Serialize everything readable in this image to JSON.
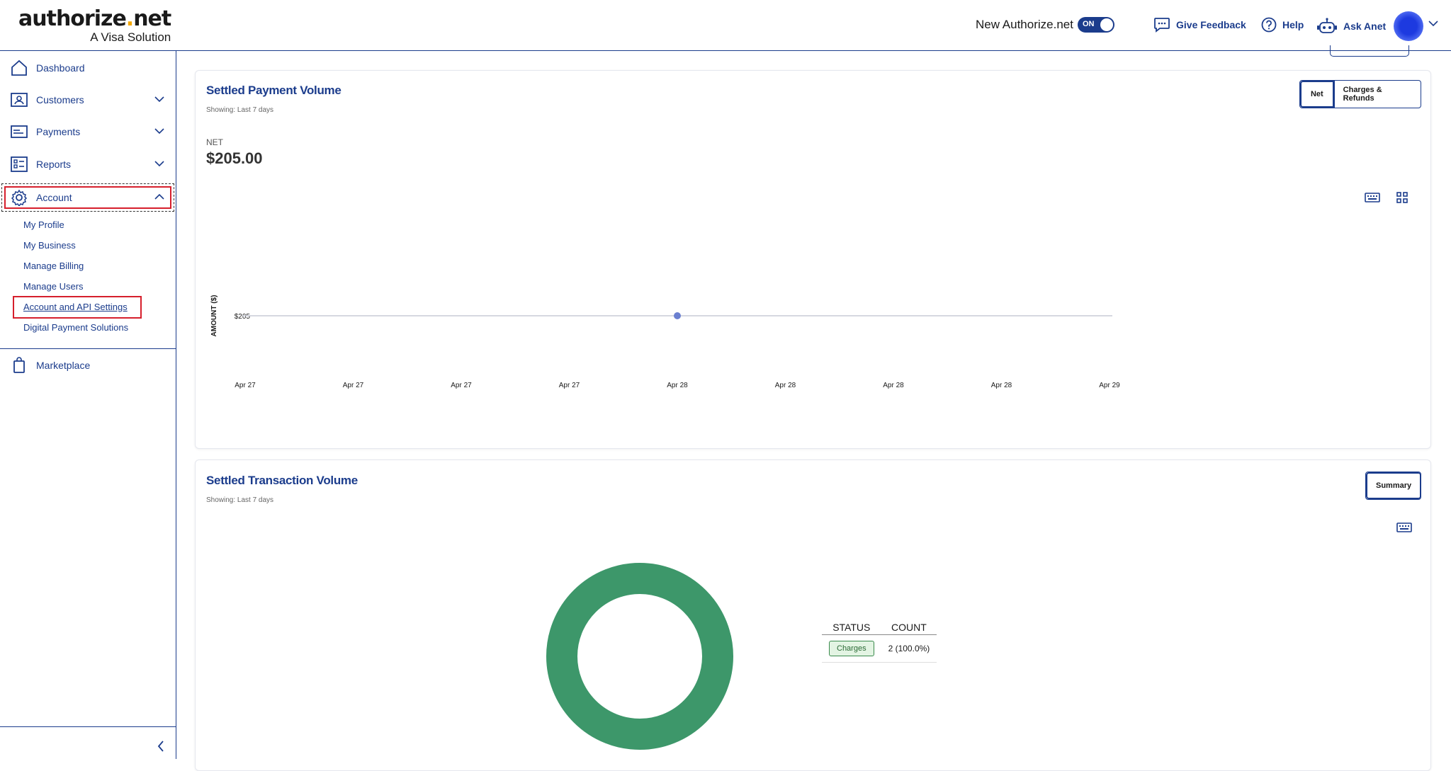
{
  "header": {
    "brand_main": "authorize",
    "brand_dot": ".",
    "brand_tld": "net",
    "tagline": "A Visa Solution",
    "toggle_label": "New Authorize.net",
    "toggle_state": "ON",
    "feedback": "Give Feedback",
    "help": "Help",
    "ask": "Ask Anet"
  },
  "sidebar": {
    "items": [
      {
        "label": "Dashboard",
        "icon": "home-icon"
      },
      {
        "label": "Customers",
        "icon": "customers-icon"
      },
      {
        "label": "Payments",
        "icon": "payments-icon"
      },
      {
        "label": "Reports",
        "icon": "reports-icon"
      },
      {
        "label": "Account",
        "icon": "gear-icon"
      }
    ],
    "account_sub": [
      "My Profile",
      "My Business",
      "Manage Billing",
      "Manage Users",
      "Account and API Settings",
      "Digital Payment Solutions"
    ],
    "marketplace": "Marketplace"
  },
  "payment_card": {
    "title": "Settled Payment Volume",
    "subtitle": "Showing: Last 7 days",
    "seg_net": "Net",
    "seg_charges": "Charges & Refunds",
    "net_label": "NET",
    "net_value": "$205.00"
  },
  "chart_data": {
    "type": "line",
    "ylabel": "AMOUNT ($)",
    "y_tick": "$205",
    "categories": [
      "Apr 27",
      "Apr 27",
      "Apr 27",
      "Apr 27",
      "Apr 28",
      "Apr 28",
      "Apr 28",
      "Apr 28",
      "Apr 29"
    ],
    "series": [
      {
        "values": [
          205,
          205,
          205,
          205,
          205,
          205,
          205,
          205,
          205
        ]
      }
    ],
    "point_index": 4,
    "color": "#6a7fd0"
  },
  "transaction_card": {
    "title": "Settled Transaction Volume",
    "subtitle": "Showing: Last 7 days",
    "summary": "Summary",
    "donut": {
      "values": [
        2
      ],
      "labels": [
        "Charges"
      ],
      "color": "#3d976a"
    },
    "table": {
      "headers": [
        "STATUS",
        "COUNT"
      ],
      "rows": [
        {
          "status": "Charges",
          "count": "2 (100.0%)"
        }
      ]
    }
  }
}
